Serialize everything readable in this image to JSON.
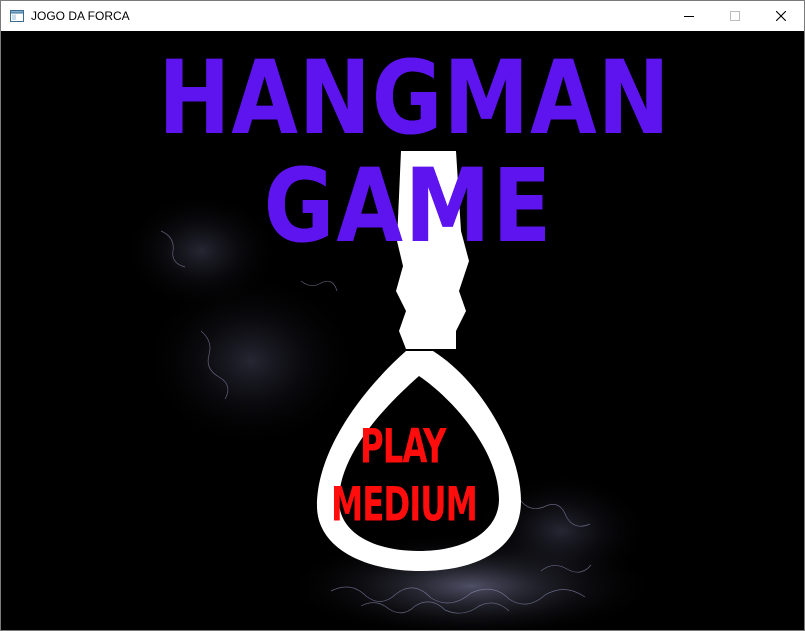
{
  "window": {
    "title": "JOGO DA FORCA",
    "controls": {
      "minimize": "minimize-icon",
      "maximize": "maximize-icon",
      "close": "close-icon"
    }
  },
  "game": {
    "title_line_1": "HANGMAN",
    "title_line_2": "GAME",
    "menu": {
      "play_label": "PLAY",
      "difficulty_label": "MEDIUM"
    }
  },
  "colors": {
    "title": "#5d14ef",
    "menu_text": "#ff0d0d",
    "rope": "#ffffff",
    "background": "#000000"
  }
}
